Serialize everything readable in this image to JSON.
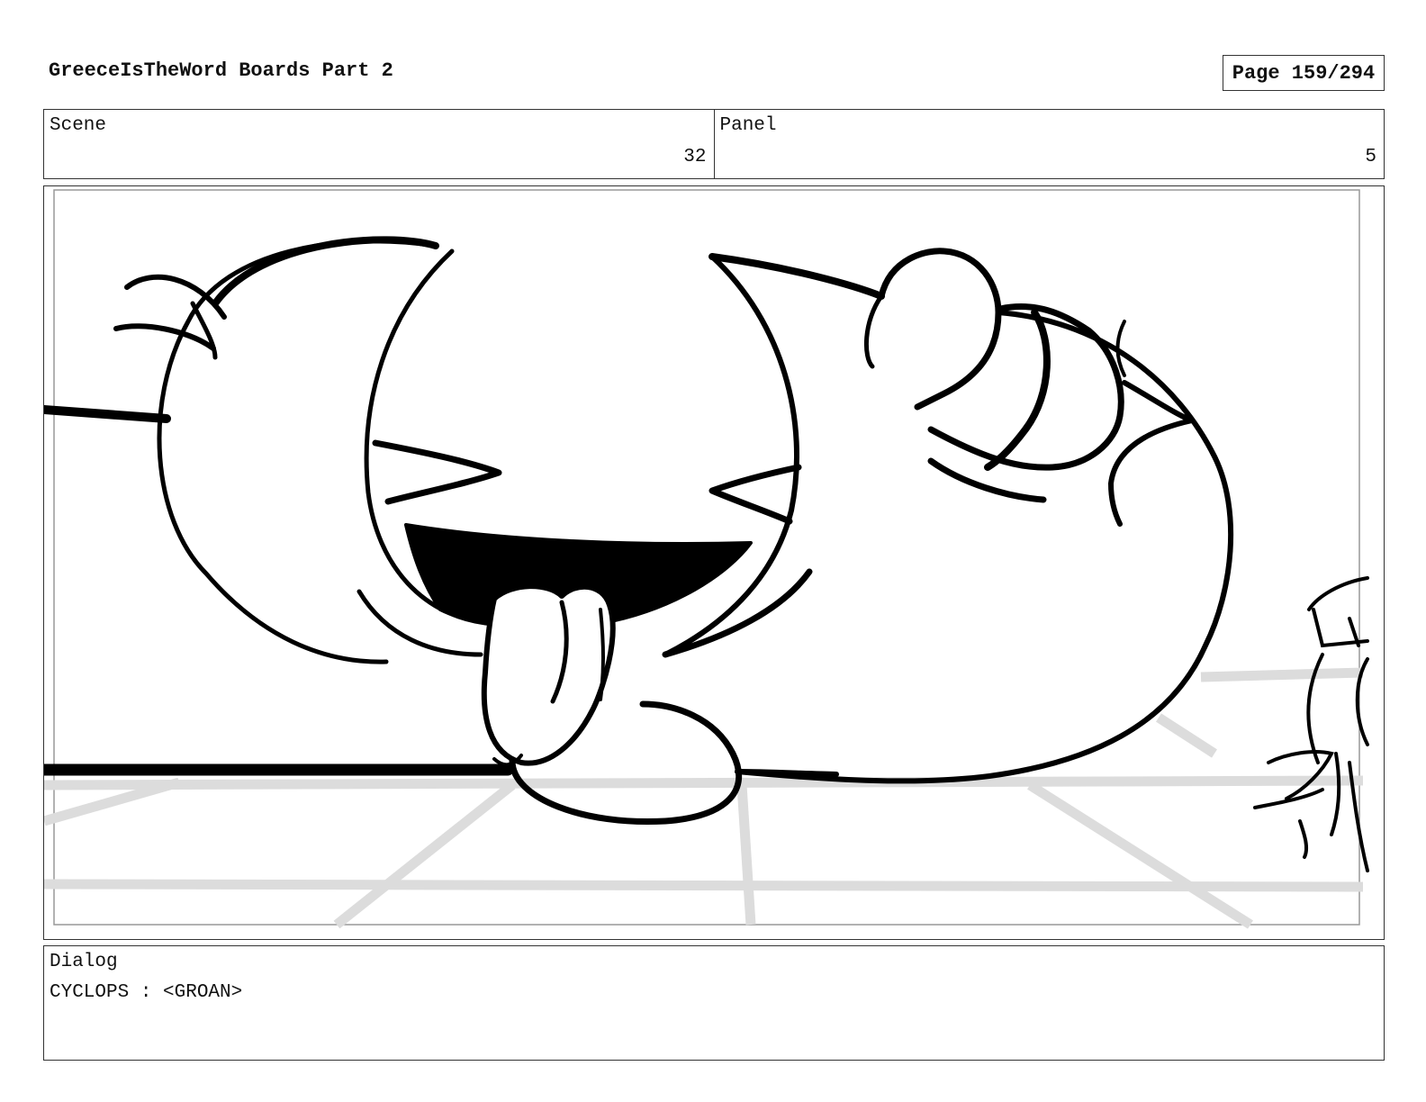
{
  "header": {
    "title": "GreeceIsTheWord Boards Part 2",
    "page": "Page 159/294"
  },
  "info": {
    "scene_label": "Scene",
    "scene_value": "32",
    "panel_label": "Panel",
    "panel_value": "5"
  },
  "dialog": {
    "label": "Dialog",
    "text": "CYCLOPS : <GROAN>"
  }
}
